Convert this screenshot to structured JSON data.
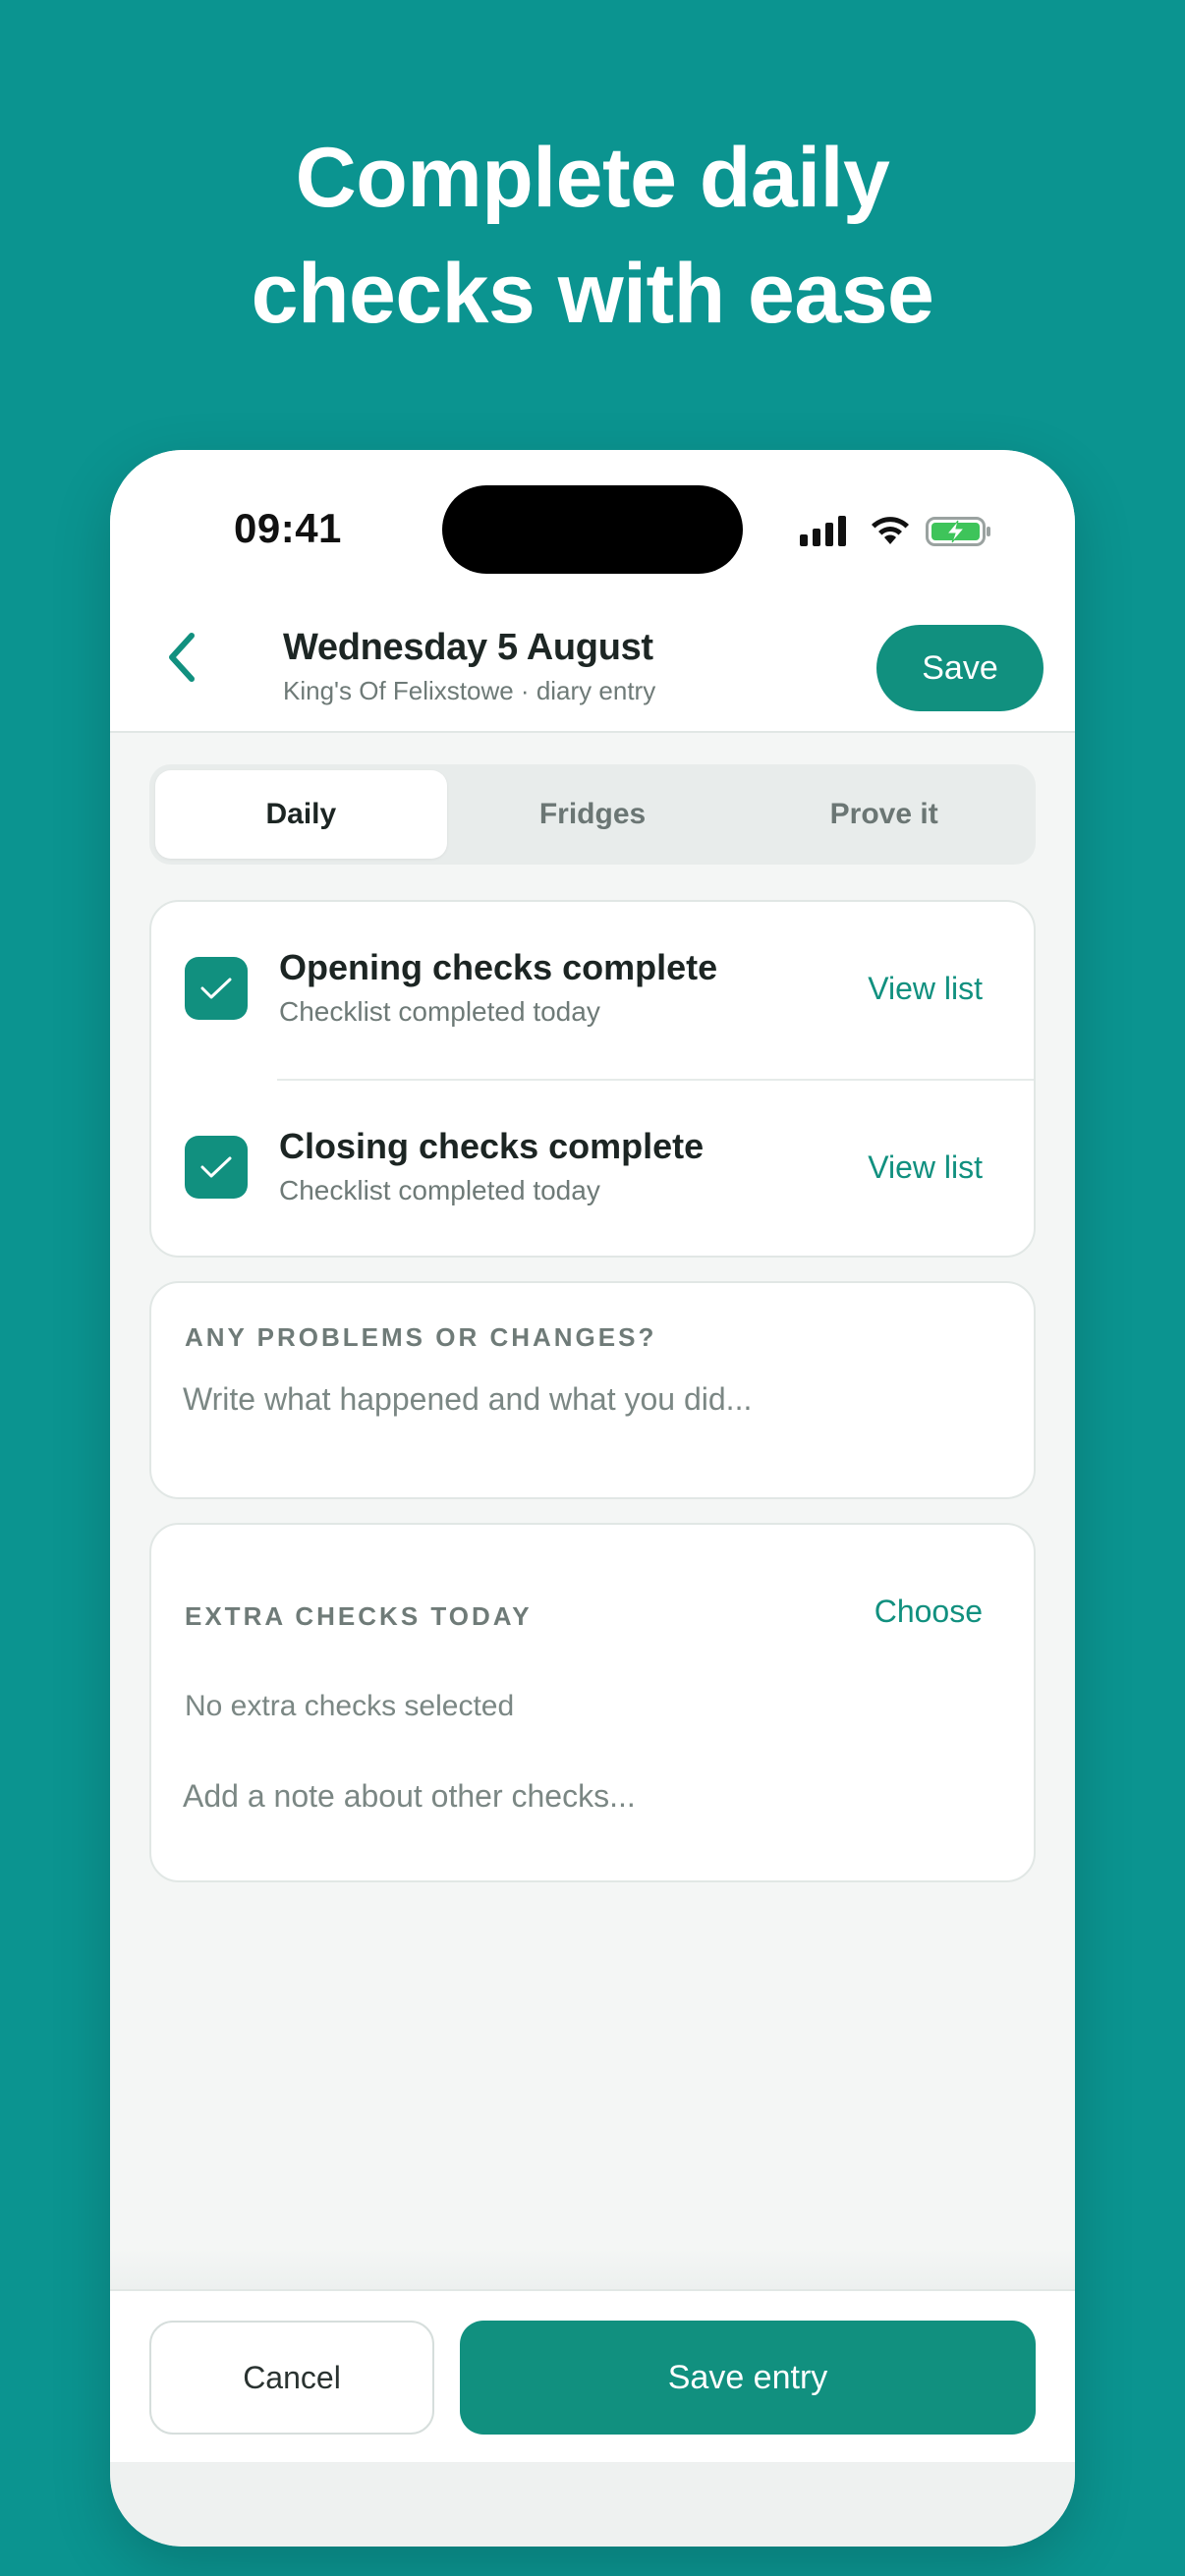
{
  "marketing": {
    "headline_line1": "Complete daily",
    "headline_line2": "checks with ease"
  },
  "status_bar": {
    "time": "09:41",
    "icons": [
      "signal-icon",
      "wifi-icon",
      "battery-charging-icon"
    ]
  },
  "header": {
    "title": "Wednesday 5 August",
    "subtitle": "King's Of Felixstowe · diary entry",
    "save_label": "Save",
    "back_icon": "chevron-left-icon"
  },
  "tabs": [
    {
      "label": "Daily",
      "active": true
    },
    {
      "label": "Fridges",
      "active": false
    },
    {
      "label": "Prove it",
      "active": false
    }
  ],
  "checks": [
    {
      "title": "Opening checks complete",
      "subtitle": "Checklist completed today",
      "link": "View list",
      "checked": true
    },
    {
      "title": "Closing checks complete",
      "subtitle": "Checklist completed today",
      "link": "View list",
      "checked": true
    }
  ],
  "problems": {
    "label": "ANY PROBLEMS OR CHANGES?",
    "placeholder": "Write what happened and what you did..."
  },
  "extra_checks": {
    "label": "EXTRA CHECKS TODAY",
    "choose_label": "Choose",
    "empty_text": "No extra checks selected",
    "note_placeholder": "Add a note about other checks..."
  },
  "footer": {
    "cancel_label": "Cancel",
    "save_entry_label": "Save entry"
  },
  "colors": {
    "background": "#0b9490",
    "accent": "#11907f",
    "text_dark": "#1c2523",
    "text_muted": "#6e7a77"
  }
}
